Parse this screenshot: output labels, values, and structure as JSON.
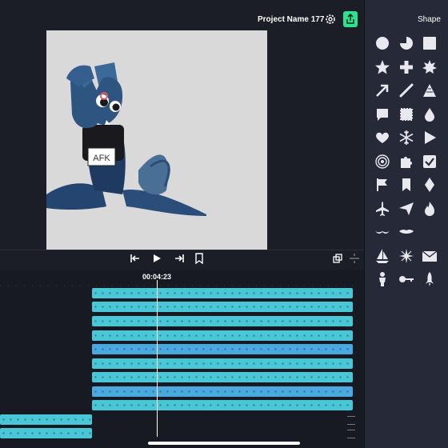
{
  "header": {
    "project_name": "Project Name 177 _",
    "settings_icon": "gear-icon",
    "export_icon": "share-icon",
    "accent": "#2fe08e"
  },
  "canvas": {
    "background": "#d9d9d9",
    "sticker_text": "AFK"
  },
  "playback": {
    "controls": [
      "skip-to-start-icon",
      "play-icon",
      "skip-to-end-icon",
      "bookmark-icon",
      "loop-icon",
      "split-icon"
    ]
  },
  "timeline": {
    "timecode": "00:04:23",
    "track_color": "#49c7d6"
  },
  "sidebar": {
    "title": "Shape",
    "shapes": [
      "circle-icon",
      "pie-icon",
      "square-icon",
      "star-icon",
      "plus-icon",
      "starburst-icon",
      "arrow-icon",
      "line-icon",
      "triangle-icon",
      "speech-bubble-icon",
      "stamp-icon",
      "drop-icon",
      "heart-icon",
      "snowflake-icon",
      "play-icon",
      "spiral-icon",
      "puzzle-icon",
      "checkmark-icon",
      "flag-icon",
      "bookmark-icon",
      "diamond-icon",
      "airplane-icon",
      "paper-plane-icon",
      "flame-icon",
      "mustache-icon",
      "lips-icon",
      "moon-icon",
      "sailboat-icon",
      "sparkle-icon",
      "envelope-icon",
      "person-icon",
      "key-icon",
      "rocket-icon"
    ]
  }
}
